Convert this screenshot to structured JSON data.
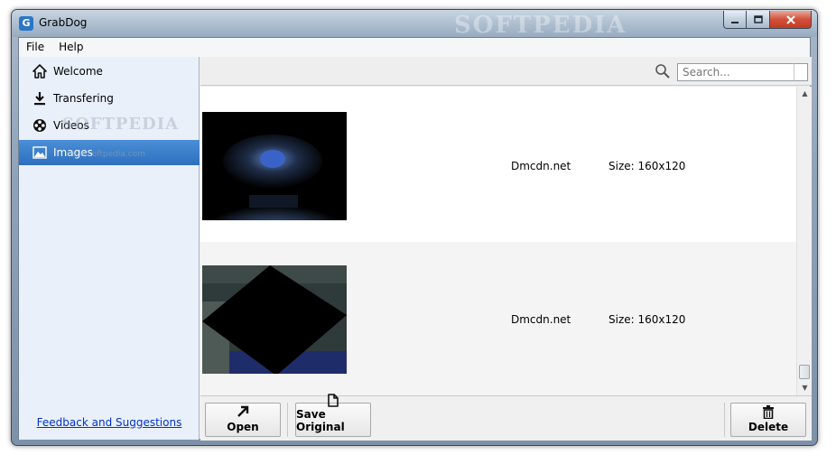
{
  "window": {
    "title": "GrabDog",
    "watermark": "SOFTPEDIA"
  },
  "menu": {
    "file": "File",
    "help": "Help"
  },
  "sidebar": {
    "items": [
      {
        "label": "Welcome",
        "icon": "home-icon"
      },
      {
        "label": "Transfering",
        "icon": "download-icon"
      },
      {
        "label": "Videos",
        "icon": "film-reel-icon"
      },
      {
        "label": "Images",
        "icon": "picture-icon"
      }
    ],
    "selected": "Images",
    "watermark": "SOFTPEDIA",
    "watermark_url": "www.softpedia.com",
    "feedback_link": "Feedback and Suggestions"
  },
  "search": {
    "placeholder": "Search..."
  },
  "images": [
    {
      "source": "Dmcdn.net",
      "size": "Size: 160x120"
    },
    {
      "source": "Dmcdn.net",
      "size": "Size: 160x120"
    }
  ],
  "toolbar": {
    "open_label": "Open",
    "save_original_label": "Save Original",
    "delete_label": "Delete"
  },
  "colors": {
    "selection": "#2d6fbf",
    "link": "#0033cc",
    "close_button": "#c33a24"
  }
}
